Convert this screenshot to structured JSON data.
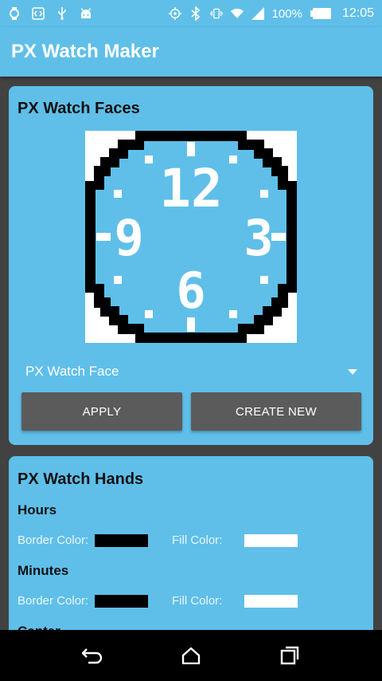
{
  "status_bar": {
    "battery": "100%",
    "time": "12:05"
  },
  "app_bar": {
    "title": "PX Watch Maker"
  },
  "faces_card": {
    "title": "PX Watch Faces",
    "face_numerals": [
      "12",
      "3",
      "6",
      "9"
    ],
    "spinner_value": "PX Watch Face",
    "apply_label": "APPLY",
    "create_label": "CREATE NEW"
  },
  "hands_card": {
    "title": "PX Watch Hands",
    "sections": [
      {
        "name": "Hours",
        "border_label": "Border Color:",
        "fill_label": "Fill Color:",
        "border_color": "#000000",
        "fill_color": "#ffffff"
      },
      {
        "name": "Minutes",
        "border_label": "Border Color:",
        "fill_label": "Fill Color:",
        "border_color": "#000000",
        "fill_color": "#ffffff"
      }
    ],
    "partial_section": "Center"
  },
  "colors": {
    "primary": "#5fbfe9",
    "background": "#424242",
    "button": "#5b5b5b"
  },
  "icons": {
    "status_left": [
      "watch-icon",
      "code-icon",
      "usb-icon",
      "android-icon"
    ],
    "status_right": [
      "crosshair-icon",
      "bluetooth-icon",
      "vibrate-icon",
      "wifi-icon",
      "signal-icon",
      "battery-icon"
    ],
    "nav": [
      "back-icon",
      "home-icon",
      "recents-icon"
    ]
  }
}
